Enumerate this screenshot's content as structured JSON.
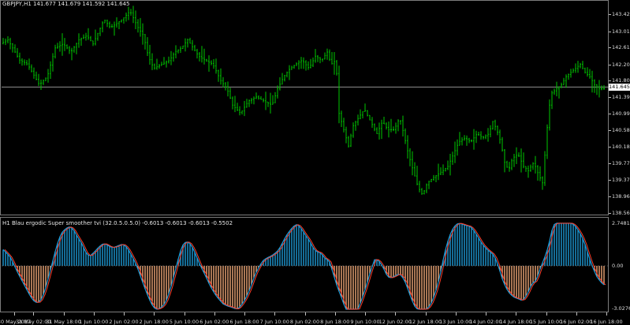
{
  "chart": {
    "title": "GBPJPY,H1  141.677 141.679 141.592 141.645",
    "current_price": "141.645",
    "colors": {
      "background": "#000000",
      "bar": "#00c800",
      "grid_line": "#c0c0c0",
      "hist_pos": "#1e9bd7",
      "hist_neg": "#f0a878",
      "signal": "#ff3c28"
    }
  },
  "indicator": {
    "title": "H1 Blau ergodic Super smoother tvi (32.0.5.0.5.0) -0.6013 -0.6013 -0.6013 -0.5502",
    "max_label": "2.7481",
    "zero_label": "0.00",
    "min_label": "-3.0276"
  },
  "price_axis": {
    "ticks": [
      "143.420",
      "143.010",
      "142.610",
      "142.200",
      "141.800",
      "141.390",
      "140.990",
      "140.580",
      "140.180",
      "139.770",
      "139.370",
      "138.960",
      "138.560"
    ]
  },
  "time_axis": {
    "ticks": [
      "30 May 2017",
      "31 May 02:00",
      "31 May 18:00",
      "1 Jun 10:00",
      "2 Jun 02:00",
      "2 Jun 18:00",
      "5 Jun 10:00",
      "6 Jun 02:00",
      "6 Jun 18:00",
      "7 Jun 10:00",
      "8 Jun 02:00",
      "8 Jun 18:00",
      "9 Jun 10:00",
      "12 Jun 02:00",
      "12 Jun 18:00",
      "13 Jun 10:00",
      "14 Jun 02:00",
      "14 Jun 18:00",
      "15 Jun 10:00",
      "16 Jun 02:00",
      "16 Jun 18:00"
    ]
  },
  "chart_data": {
    "type": "ohlc",
    "symbol": "GBPJPY",
    "timeframe": "H1",
    "ylim": [
      138.56,
      143.62
    ],
    "close_path": [
      [
        0,
        142.7
      ],
      [
        10,
        142.8
      ],
      [
        25,
        142.3
      ],
      [
        35,
        142.2
      ],
      [
        50,
        141.7
      ],
      [
        60,
        141.9
      ],
      [
        70,
        142.6
      ],
      [
        80,
        142.7
      ],
      [
        90,
        142.5
      ],
      [
        100,
        142.8
      ],
      [
        110,
        142.9
      ],
      [
        118,
        142.7
      ],
      [
        125,
        143.0
      ],
      [
        132,
        143.3
      ],
      [
        140,
        143.1
      ],
      [
        148,
        143.2
      ],
      [
        155,
        143.3
      ],
      [
        165,
        143.5
      ],
      [
        175,
        143.1
      ],
      [
        182,
        142.9
      ],
      [
        188,
        142.4
      ],
      [
        195,
        142.1
      ],
      [
        205,
        142.2
      ],
      [
        215,
        142.3
      ],
      [
        222,
        142.5
      ],
      [
        230,
        142.6
      ],
      [
        238,
        142.8
      ],
      [
        245,
        142.6
      ],
      [
        252,
        142.4
      ],
      [
        260,
        142.3
      ],
      [
        270,
        142.2
      ],
      [
        280,
        141.8
      ],
      [
        288,
        141.6
      ],
      [
        295,
        141.2
      ],
      [
        305,
        141.0
      ],
      [
        315,
        141.3
      ],
      [
        325,
        141.4
      ],
      [
        335,
        141.3
      ],
      [
        345,
        141.2
      ],
      [
        352,
        141.6
      ],
      [
        360,
        141.9
      ],
      [
        368,
        142.1
      ],
      [
        375,
        142.2
      ],
      [
        383,
        142.3
      ],
      [
        392,
        142.1
      ],
      [
        400,
        142.4
      ],
      [
        408,
        142.3
      ],
      [
        415,
        142.5
      ],
      [
        420,
        142.2
      ],
      [
        426,
        142.3
      ],
      [
        430,
        141.0
      ],
      [
        436,
        140.6
      ],
      [
        442,
        140.2
      ],
      [
        448,
        140.7
      ],
      [
        455,
        140.9
      ],
      [
        462,
        141.1
      ],
      [
        470,
        140.8
      ],
      [
        478,
        140.5
      ],
      [
        485,
        140.8
      ],
      [
        492,
        140.6
      ],
      [
        500,
        140.6
      ],
      [
        507,
        140.9
      ],
      [
        512,
        140.5
      ],
      [
        518,
        140.0
      ],
      [
        524,
        139.6
      ],
      [
        530,
        139.2
      ],
      [
        536,
        139.0
      ],
      [
        542,
        139.3
      ],
      [
        548,
        139.4
      ],
      [
        555,
        139.5
      ],
      [
        562,
        139.6
      ],
      [
        568,
        139.7
      ],
      [
        575,
        140.0
      ],
      [
        582,
        140.3
      ],
      [
        590,
        140.4
      ],
      [
        597,
        140.3
      ],
      [
        605,
        140.5
      ],
      [
        612,
        140.4
      ],
      [
        620,
        140.5
      ],
      [
        625,
        140.8
      ],
      [
        630,
        140.6
      ],
      [
        635,
        140.3
      ],
      [
        640,
        139.8
      ],
      [
        645,
        139.6
      ],
      [
        650,
        139.9
      ],
      [
        657,
        140.0
      ],
      [
        664,
        139.7
      ],
      [
        670,
        139.6
      ],
      [
        677,
        139.8
      ],
      [
        683,
        139.5
      ],
      [
        688,
        139.3
      ],
      [
        692,
        140.2
      ],
      [
        696,
        141.1
      ],
      [
        700,
        141.5
      ],
      [
        706,
        141.6
      ],
      [
        712,
        141.7
      ],
      [
        718,
        141.9
      ],
      [
        724,
        142.0
      ],
      [
        730,
        142.1
      ],
      [
        736,
        142.2
      ],
      [
        742,
        142.0
      ],
      [
        748,
        141.9
      ],
      [
        754,
        141.7
      ],
      [
        760,
        141.6
      ],
      [
        766,
        141.6
      ],
      [
        770,
        141.65
      ]
    ]
  }
}
